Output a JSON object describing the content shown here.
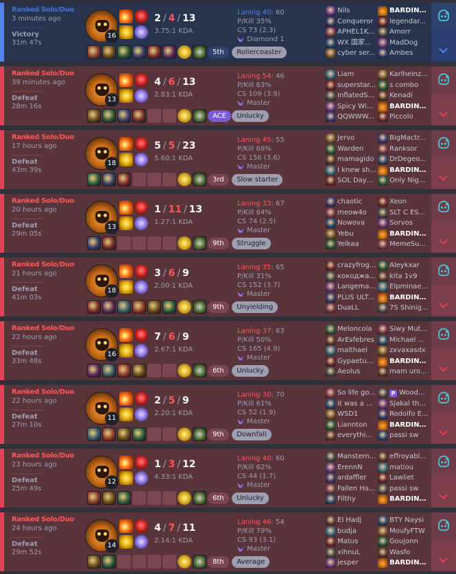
{
  "colors": {
    "win": "#5383e8",
    "loss": "#e84057",
    "win_bg": "#28344e",
    "loss_bg": "#59343b"
  },
  "matches": [
    {
      "queue": "Ranked Solo/Duo",
      "time_ago": "3 minutes ago",
      "result": "Victory",
      "duration": "31m 47s",
      "win": true,
      "level": "16",
      "kills": "2",
      "deaths": "4",
      "assists": "13",
      "kda": "3.75:1 KDA",
      "laning_label": "Laning 40",
      "laning_score": ": 60",
      "pkill": "P/Kill 35%",
      "cs": "CS 73 (2.3)",
      "rank": "Diamond 1",
      "items": 7,
      "badges": [
        {
          "text": "5th",
          "style": "plain"
        },
        {
          "text": "Rollercoaster",
          "style": "alt"
        }
      ],
      "team1": [
        "Nils",
        "Conqueror",
        "APHEL1K...",
        "WX 国家...",
        "cyber ser..."
      ],
      "team2": [
        "BARDINE...",
        "legendar...",
        "Amorr",
        "MadDog",
        "Ambes"
      ]
    },
    {
      "queue": "Ranked Solo/Duo",
      "time_ago": "39 minutes ago",
      "result": "Defeat",
      "duration": "28m 16s",
      "win": false,
      "level": "13",
      "kills": "4",
      "deaths": "6",
      "assists": "13",
      "kda": "2.83:1 KDA",
      "laning_label": "Laning 54",
      "laning_score": ": 46",
      "pkill": "P/Kill 63%",
      "cs": "CS 109 (3.9)",
      "rank": "Master",
      "items": 4,
      "badges": [
        {
          "text": "ACE",
          "style": "ace"
        },
        {
          "text": "Unlucky",
          "style": "alt"
        }
      ],
      "team1": [
        "Liam",
        "superstar...",
        "InflatedS...",
        "Spicy Win...",
        "QQWWW..."
      ],
      "team2": [
        "Karlheinz...",
        "s combo",
        "Kenadi",
        "BARDINE...",
        "Piccolo"
      ]
    },
    {
      "queue": "Ranked Solo/Duo",
      "time_ago": "17 hours ago",
      "result": "Defeat",
      "duration": "43m 39s",
      "win": false,
      "level": "18",
      "kills": "5",
      "deaths": "5",
      "assists": "23",
      "kda": "5.60:1 KDA",
      "laning_label": "Laning 45",
      "laning_score": ": 55",
      "pkill": "P/Kill 68%",
      "cs": "CS 156 (3.6)",
      "rank": "Master",
      "items": 3,
      "badges": [
        {
          "text": "3rd",
          "style": "plain"
        },
        {
          "text": "Slow starter",
          "style": "alt"
        }
      ],
      "team1": [
        "Jervo",
        "Warden",
        "mamagido",
        "I knew sh...",
        "SOL Dayn..."
      ],
      "team2": [
        "BigMactr...",
        "Ranksor",
        "DrDegeo...",
        "BARDINE...",
        "Only Nigh..."
      ]
    },
    {
      "queue": "Ranked Solo/Duo",
      "time_ago": "20 hours ago",
      "result": "Defeat",
      "duration": "29m 05s",
      "win": false,
      "level": "13",
      "kills": "1",
      "deaths": "11",
      "assists": "13",
      "kda": "1.27:1 KDA",
      "laning_label": "Laning 33",
      "laning_score": ": 67",
      "pkill": "P/Kill 64%",
      "cs": "CS 74 (2.5)",
      "rank": "Master",
      "items": 2,
      "badges": [
        {
          "text": "9th",
          "style": "plain"
        },
        {
          "text": "Struggle",
          "style": "alt"
        }
      ],
      "team1": [
        "chaotic",
        "meow4o",
        "Nowova",
        "Yebu",
        "Yelkaa"
      ],
      "team2": [
        "Xeon",
        "SLT C ES...",
        "Sorvos",
        "BARDINE...",
        "MemeSu..."
      ]
    },
    {
      "queue": "Ranked Solo/Duo",
      "time_ago": "21 hours ago",
      "result": "Defeat",
      "duration": "41m 03s",
      "win": false,
      "level": "18",
      "kills": "3",
      "deaths": "6",
      "assists": "9",
      "kda": "2.00:1 KDA",
      "laning_label": "Laning 35",
      "laning_score": ": 65",
      "pkill": "P/Kill 31%",
      "cs": "CS 152 (3.7)",
      "rank": "Master",
      "items": 6,
      "badges": [
        {
          "text": "9th",
          "style": "plain"
        },
        {
          "text": "Unyielding",
          "style": "alt"
        }
      ],
      "team1": [
        "crazyfrog...",
        "кокоджа...",
        "Langema...",
        "PLUS ULT...",
        "DuaLL"
      ],
      "team2": [
        "Aleykxar",
        "kita 1v9",
        "Elpminae...",
        "BARDINE...",
        "7S Shinig..."
      ]
    },
    {
      "queue": "Ranked Solo/Duo",
      "time_ago": "22 hours ago",
      "result": "Defeat",
      "duration": "33m 48s",
      "win": false,
      "level": "16",
      "kills": "7",
      "deaths": "6",
      "assists": "9",
      "kda": "2.67:1 KDA",
      "laning_label": "Laning 37",
      "laning_score": ": 63",
      "pkill": "P/Kill 50%",
      "cs": "CS 165 (4.9)",
      "rank": "Master",
      "items": 4,
      "badges": [
        {
          "text": "6th",
          "style": "plain"
        },
        {
          "text": "Unlucky",
          "style": "alt"
        }
      ],
      "team1": [
        "Meloncola",
        "ArEsfebres",
        "malthael",
        "Gypaetus...",
        "Aeolus"
      ],
      "team2": [
        "Siwy Mut...",
        "Michael ...",
        "zxvaxasdx",
        "BARDINE...",
        "mam uro..."
      ]
    },
    {
      "queue": "Ranked Solo/Duo",
      "time_ago": "22 hours ago",
      "result": "Defeat",
      "duration": "27m 10s",
      "win": false,
      "level": "11",
      "kills": "2",
      "deaths": "5",
      "assists": "9",
      "kda": "2.20:1 KDA",
      "laning_label": "Laning 30",
      "laning_score": ": 70",
      "pkill": "P/Kill 61%",
      "cs": "CS 52 (1.9)",
      "rank": "Master",
      "items": 4,
      "badges": [
        {
          "text": "9th",
          "style": "plain"
        },
        {
          "text": "Downfall",
          "style": "alt"
        }
      ],
      "team1": [
        "So life go...",
        "it was a p...",
        "WSD1",
        "Liannton",
        "everythin..."
      ],
      "team2": [
        "Wood...",
        "Sjakal the...",
        "Rodolfo E...",
        "BARDINE...",
        "passi sw"
      ],
      "team2_badge": "P"
    },
    {
      "queue": "Ranked Solo/Duo",
      "time_ago": "23 hours ago",
      "result": "Defeat",
      "duration": "25m 49s",
      "win": false,
      "level": "12",
      "kills": "1",
      "deaths": "3",
      "assists": "12",
      "kda": "4.33:1 KDA",
      "laning_label": "Laning 40",
      "laning_score": ": 60",
      "pkill": "P/Kill 62%",
      "cs": "CS 44 (1.7)",
      "rank": "Master",
      "items": 3,
      "badges": [
        {
          "text": "6th",
          "style": "plain"
        },
        {
          "text": "Unlucky",
          "style": "alt"
        }
      ],
      "team1": [
        "Manstern...",
        "ErennN",
        "ardaffler",
        "Fallen Ha...",
        "Filthy"
      ],
      "team2": [
        "effroyabl...",
        "matiou",
        "Lawliet",
        "passi sw",
        "BARDINE..."
      ]
    },
    {
      "queue": "Ranked Solo/Duo",
      "time_ago": "24 hours ago",
      "result": "Defeat",
      "duration": "29m 52s",
      "win": false,
      "level": "14",
      "kills": "4",
      "deaths": "7",
      "assists": "11",
      "kda": "2.14:1 KDA",
      "laning_label": "Laning 46",
      "laning_score": ": 54",
      "pkill": "P/Kill 79%",
      "cs": "CS 93 (3.1)",
      "rank": "Master",
      "items": 2,
      "badges": [
        {
          "text": "8th",
          "style": "plain"
        },
        {
          "text": "Average",
          "style": "alt"
        }
      ],
      "team1": [
        "El Hadj",
        "budja",
        "Matus",
        "xihnuL",
        "jesper"
      ],
      "team2": [
        "BTY Naysi",
        "MoufyFTW",
        "Goujonn",
        "Wasfo",
        "BARDINE..."
      ]
    }
  ]
}
